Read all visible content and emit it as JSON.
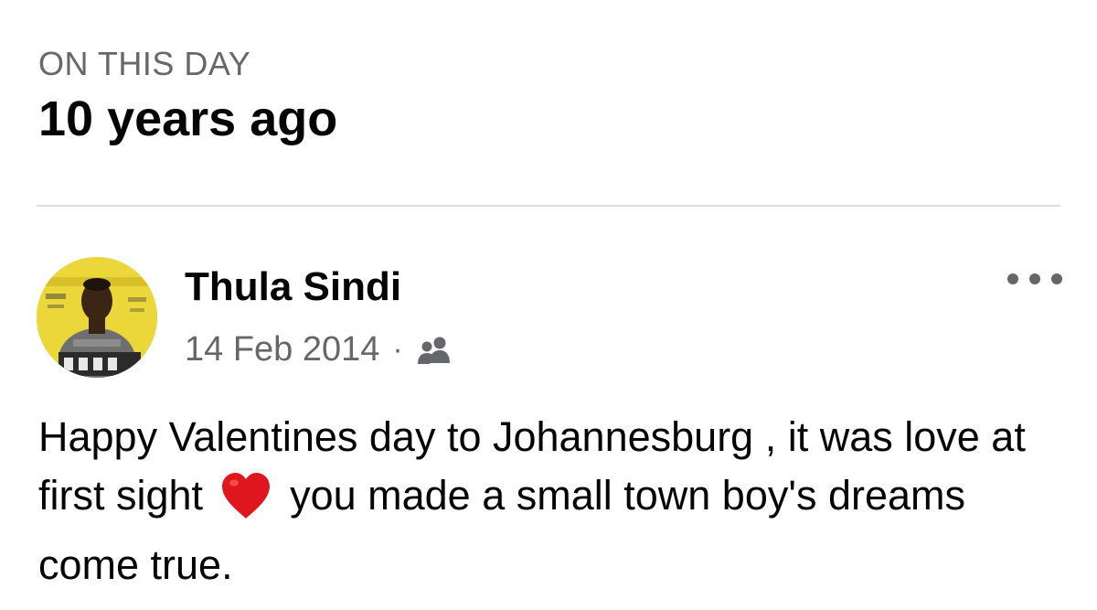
{
  "memory": {
    "section_label": "ON THIS DAY",
    "years_ago": "10 years ago"
  },
  "post": {
    "author_name": "Thula Sindi",
    "date": "14 Feb 2014",
    "meta_separator": "·",
    "audience_icon": "friends-icon",
    "more_icon": "more-options-icon",
    "text_before_emoji": "Happy Valentines day to Johannesburg , it was love at first sight",
    "emoji": "heart-emoji",
    "text_after_emoji": "you made a small town boy's dreams come true."
  },
  "colors": {
    "primary_text": "#050505",
    "secondary_text": "#65676b",
    "divider": "#dadde1",
    "heart": "#e0161e",
    "avatar_background": "#e7cf2c"
  }
}
